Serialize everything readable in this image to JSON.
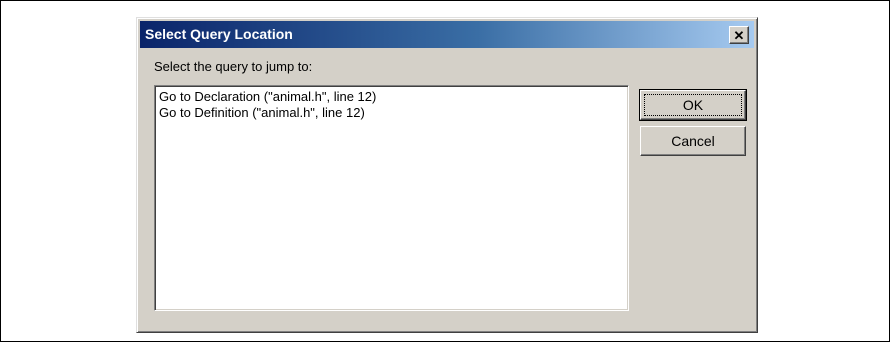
{
  "dialog": {
    "title": "Select Query Location",
    "close_label": "✕",
    "prompt": "Select the query to jump to:",
    "items": [
      {
        "label": "Go to Declaration (\"animal.h\", line 12)"
      },
      {
        "label": "Go to Definition (\"animal.h\", line 12)"
      }
    ],
    "ok_label": "OK",
    "cancel_label": "Cancel"
  }
}
